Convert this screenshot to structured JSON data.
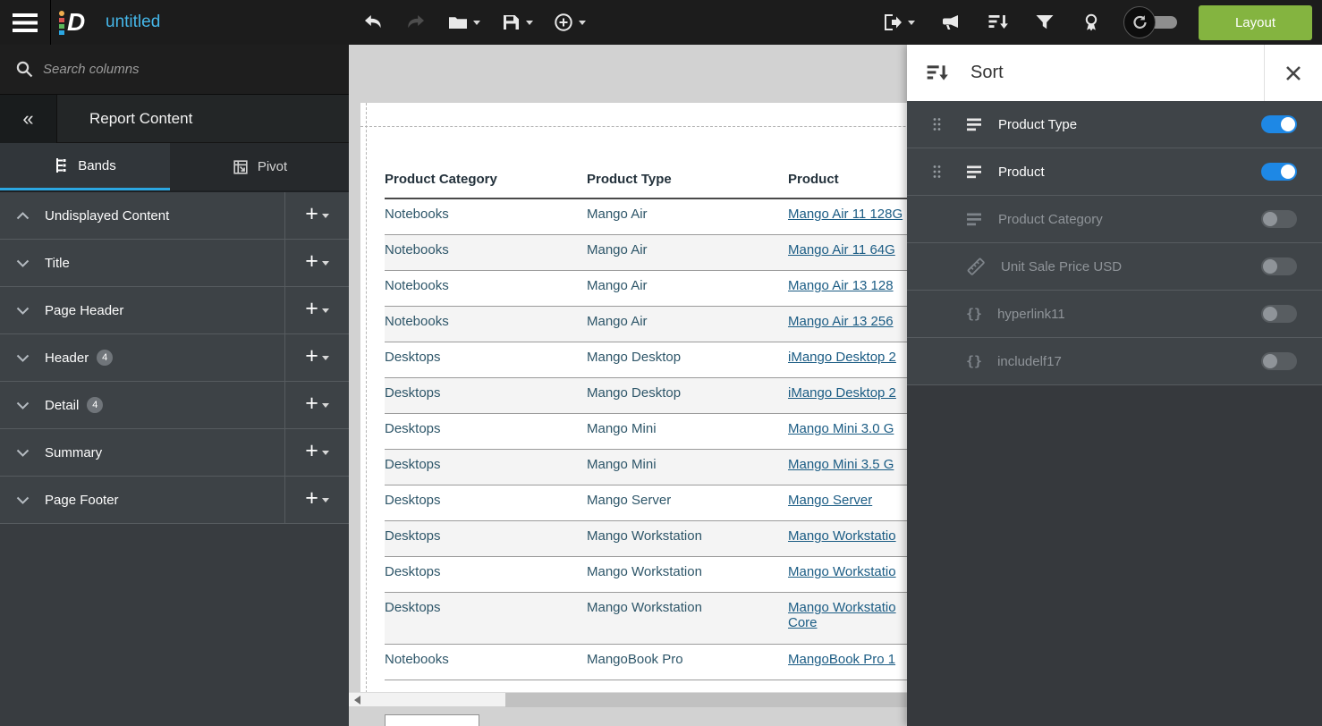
{
  "colors": {
    "accent_blue": "#2BA7E2",
    "title_blue": "#45B6E8",
    "layout_button_green": "#84B440",
    "toggle_on_blue": "#1E88E5",
    "link_navy": "#1B5C84"
  },
  "topbar": {
    "document_title": "untitled",
    "layout_button_label": "Layout"
  },
  "sidebar": {
    "search_placeholder": "Search columns",
    "panel_title": "Report Content",
    "tabs": {
      "bands": "Bands",
      "pivot": "Pivot"
    },
    "bands": [
      {
        "label": "Undisplayed Content"
      },
      {
        "label": "Title"
      },
      {
        "label": "Page Header"
      },
      {
        "label": "Header",
        "badge": "4"
      },
      {
        "label": "Detail",
        "badge": "4"
      },
      {
        "label": "Summary"
      },
      {
        "label": "Page Footer"
      }
    ]
  },
  "report": {
    "columns": [
      "Product Category",
      "Product Type",
      "Product"
    ],
    "rows": [
      {
        "category": "Notebooks",
        "type": "Mango Air",
        "product": "Mango Air 11 128G"
      },
      {
        "category": "Notebooks",
        "type": "Mango Air",
        "product": "Mango Air 11 64G"
      },
      {
        "category": "Notebooks",
        "type": "Mango Air",
        "product": "Mango Air 13 128"
      },
      {
        "category": "Notebooks",
        "type": "Mango Air",
        "product": "Mango Air 13 256"
      },
      {
        "category": "Desktops",
        "type": "Mango Desktop",
        "product": "iMango Desktop 2"
      },
      {
        "category": "Desktops",
        "type": "Mango Desktop",
        "product": "iMango Desktop 2"
      },
      {
        "category": "Desktops",
        "type": "Mango Mini",
        "product": "Mango Mini 3.0 G"
      },
      {
        "category": "Desktops",
        "type": "Mango Mini",
        "product": "Mango Mini 3.5 G"
      },
      {
        "category": "Desktops",
        "type": "Mango Server",
        "product": "Mango Server"
      },
      {
        "category": "Desktops",
        "type": "Mango Workstation",
        "product": "Mango Workstatio"
      },
      {
        "category": "Desktops",
        "type": "Mango Workstation",
        "product": "Mango Workstatio"
      },
      {
        "category": "Desktops",
        "type": "Mango Workstation",
        "product": "Mango Workstatio",
        "product_line2": "Core"
      },
      {
        "category": "Notebooks",
        "type": "MangoBook Pro",
        "product": "MangoBook Pro 1"
      }
    ]
  },
  "sort_panel": {
    "title": "Sort",
    "items": [
      {
        "label": "Product Type",
        "icon": "field-list-icon",
        "on": true,
        "draggable": true
      },
      {
        "label": "Product",
        "icon": "field-list-icon",
        "on": true,
        "draggable": true
      },
      {
        "label": "Product Category",
        "icon": "field-list-icon",
        "on": false,
        "disabled": true
      },
      {
        "label": "Unit Sale Price USD",
        "icon": "measure-icon",
        "on": false,
        "disabled": true
      },
      {
        "label": "hyperlink11",
        "icon": "formula-icon",
        "on": false,
        "disabled": true
      },
      {
        "label": "includelf17",
        "icon": "formula-icon",
        "on": false,
        "disabled": true
      }
    ]
  }
}
